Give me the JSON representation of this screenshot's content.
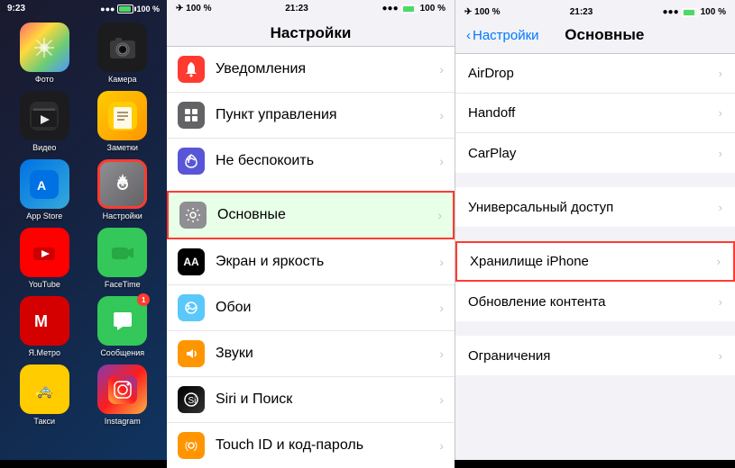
{
  "left_panel": {
    "status_bar": {
      "time": "9:23",
      "battery_percent": "100 %",
      "signal": "●●●●"
    },
    "apps": [
      {
        "id": "photos",
        "label": "Фото",
        "icon": "🌄",
        "color_class": "app-photos",
        "emoji": ""
      },
      {
        "id": "camera",
        "label": "Камера",
        "icon": "📷",
        "color_class": "app-camera"
      },
      {
        "id": "video",
        "label": "Видео",
        "icon": "🎬",
        "color_class": "app-video"
      },
      {
        "id": "notes",
        "label": "Заметки",
        "icon": "📝",
        "color_class": "app-notes"
      },
      {
        "id": "appstore",
        "label": "App Store",
        "icon": "🅐",
        "color_class": "app-appstore"
      },
      {
        "id": "settings",
        "label": "Настройки",
        "icon": "⚙",
        "color_class": "app-settings",
        "highlighted": true
      },
      {
        "id": "youtube",
        "label": "YouTube",
        "icon": "▶",
        "color_class": "app-youtube"
      },
      {
        "id": "facetime",
        "label": "FaceTime",
        "icon": "📹",
        "color_class": "app-facetime"
      },
      {
        "id": "metro",
        "label": "Я.Метро",
        "icon": "М",
        "color_class": "app-metro"
      },
      {
        "id": "messages",
        "label": "Сообщения",
        "icon": "💬",
        "color_class": "app-messages",
        "badge": "1"
      },
      {
        "id": "taxi",
        "label": "Такси",
        "icon": "🚕",
        "color_class": "app-taxi"
      },
      {
        "id": "instagram",
        "label": "Instagram",
        "icon": "📷",
        "color_class": "app-instagram"
      }
    ]
  },
  "middle_panel": {
    "status_bar": {
      "time": "21:23",
      "battery": "100 %"
    },
    "title": "Настройки",
    "items": [
      {
        "id": "notifications",
        "label": "Уведомления",
        "icon_class": "icon-notifications",
        "icon": "🔔"
      },
      {
        "id": "control",
        "label": "Пункт управления",
        "icon_class": "icon-control",
        "icon": "⊞"
      },
      {
        "id": "donotdisturb",
        "label": "Не беспокоить",
        "icon_class": "icon-donotdisturb",
        "icon": "🌙"
      },
      {
        "id": "general",
        "label": "Основные",
        "icon_class": "icon-general",
        "icon": "⚙",
        "highlighted": true
      },
      {
        "id": "display",
        "label": "Экран и яркость",
        "icon_class": "icon-display",
        "icon": "AA"
      },
      {
        "id": "wallpaper",
        "label": "Обои",
        "icon_class": "icon-wallpaper",
        "icon": "✿"
      },
      {
        "id": "sounds",
        "label": "Звуки",
        "icon_class": "icon-sounds",
        "icon": "🔊"
      },
      {
        "id": "siri",
        "label": "Siri и Поиск",
        "icon_class": "icon-siri",
        "icon": "⬡"
      },
      {
        "id": "touchid",
        "label": "Touch ID и код-пароль",
        "icon_class": "icon-notifications",
        "icon": "⬡"
      }
    ]
  },
  "right_panel": {
    "status_bar": {
      "time": "21:23",
      "battery": "100 %"
    },
    "back_label": "Настройки",
    "title": "Основные",
    "items": [
      {
        "id": "airdrop",
        "label": "AirDrop"
      },
      {
        "id": "handoff",
        "label": "Handoff"
      },
      {
        "id": "carplay",
        "label": "CarPlay"
      },
      {
        "id": "accessibility",
        "label": "Универсальный доступ"
      },
      {
        "id": "iphone-storage",
        "label": "Хранилище iPhone",
        "highlighted": true
      },
      {
        "id": "content-update",
        "label": "Обновление контента"
      },
      {
        "id": "restrictions",
        "label": "Ограничения"
      }
    ]
  }
}
